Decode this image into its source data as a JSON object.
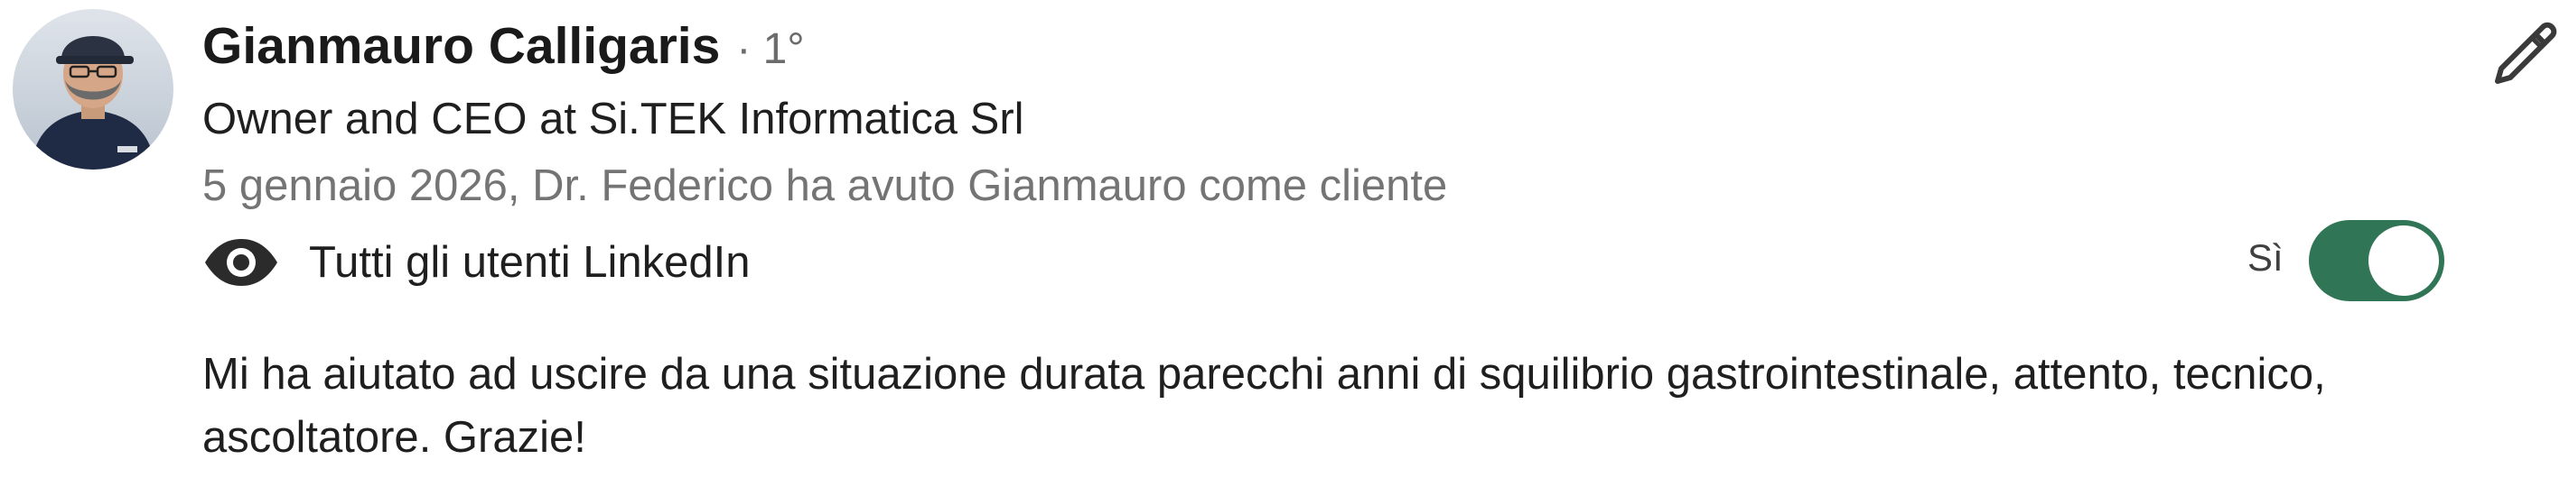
{
  "recommender": {
    "name": "Gianmauro Calligaris",
    "degree": "· 1°",
    "headline": "Owner and CEO at Si.TEK Informatica Srl",
    "meta": "5 gennaio 2026, Dr. Federico ha avuto Gianmauro come cliente"
  },
  "visibility": {
    "icon": "eye-icon",
    "label": "Tutti gli utenti LinkedIn"
  },
  "toggle": {
    "label": "Sì",
    "checked": true,
    "color": "#2f7556"
  },
  "edit": {
    "icon": "pencil-icon"
  },
  "recommendation": {
    "text": "Mi ha aiutato ad uscire da una situazione durata parecchi anni di squilibrio gastrointestinale, attento, tecnico, ascoltatore. Grazie!"
  }
}
